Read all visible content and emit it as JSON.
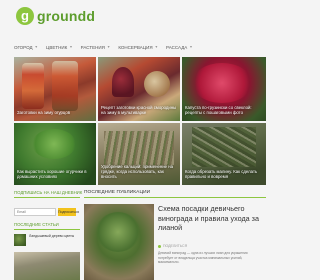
{
  "logo": {
    "mark": "g",
    "text": "groundd"
  },
  "nav": {
    "items": [
      {
        "label": "ОГОРОД",
        "has_caret": true
      },
      {
        "label": "ЦВЕТНИК",
        "has_caret": true
      },
      {
        "label": "РАСТЕНИЯ",
        "has_caret": true
      },
      {
        "label": "КОНСЕРВАЦИЯ",
        "has_caret": true
      },
      {
        "label": "РАССАДА",
        "has_caret": true
      }
    ]
  },
  "tiles": [
    {
      "caption": "Заготовки на зиму огурцов"
    },
    {
      "caption": "Рецепт заготовки красной смородины на зиму в мультиварке"
    },
    {
      "caption": "Капуста по-грузински со свеклой: рецепты с пошаговыми фото"
    },
    {
      "caption": "Как вырастить хорошие огурчики в домашних условиях"
    },
    {
      "caption": "Удобрение кальций: применение на грядке, когда использовать, как вносить"
    },
    {
      "caption": "Когда обрезать малину. Как сделать правильно и вовремя"
    }
  ],
  "sidebar": {
    "subscribe_heading": "ПОДПИШИСЬ НА НАШ ДНЕВНИК",
    "email_placeholder": "Email",
    "subscribe_button": "Подписаться",
    "popular_heading": "ПОСЛЕДНИЕ СТАТЬИ",
    "popular_post": "Ландышевый дерево цветы"
  },
  "main": {
    "heading": "ПОСЛЕДНИЕ ПУБЛИКАЦИИ",
    "post_title": "Схема посадки девичьего винограда и правила ухода за лианой",
    "post_meta": "ПОДЕЛИТЬСЯ",
    "post_excerpt": "Девичий виноград — одна из лучших лиан для украшения потребует от владельца участка минимальных усилий, максимально."
  },
  "colors": {
    "accent": "#8dc63f",
    "brand_text": "#5d9d2d",
    "button": "#f2c21b"
  }
}
